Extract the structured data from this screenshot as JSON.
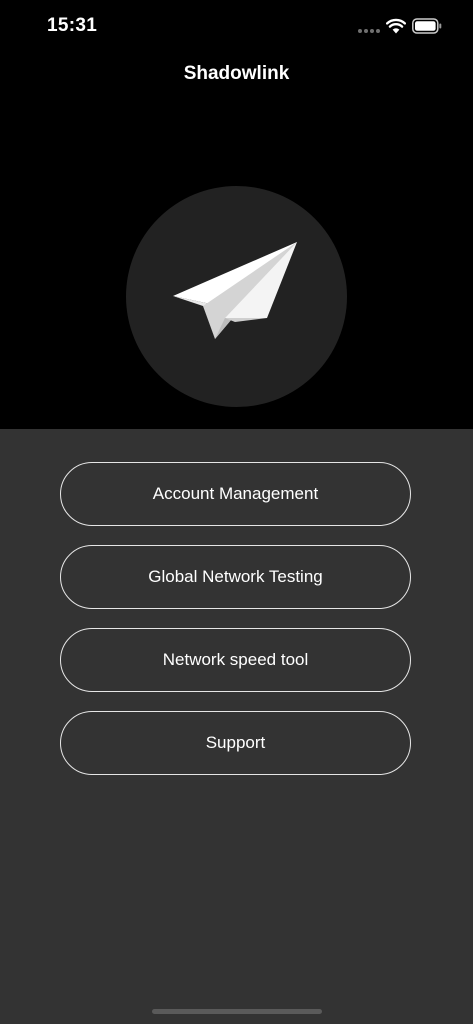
{
  "status_bar": {
    "time": "15:31"
  },
  "header": {
    "title": "Shadowlink"
  },
  "logo": {
    "icon": "paper-plane-icon"
  },
  "menu": {
    "items": [
      {
        "label": "Account Management"
      },
      {
        "label": "Global Network Testing"
      },
      {
        "label": "Network speed tool"
      },
      {
        "label": "Support"
      }
    ]
  },
  "colors": {
    "top_background": "#000000",
    "bottom_background": "#333333",
    "circle": "#222222",
    "button_border": "#e6e6e6",
    "text": "#ffffff"
  }
}
